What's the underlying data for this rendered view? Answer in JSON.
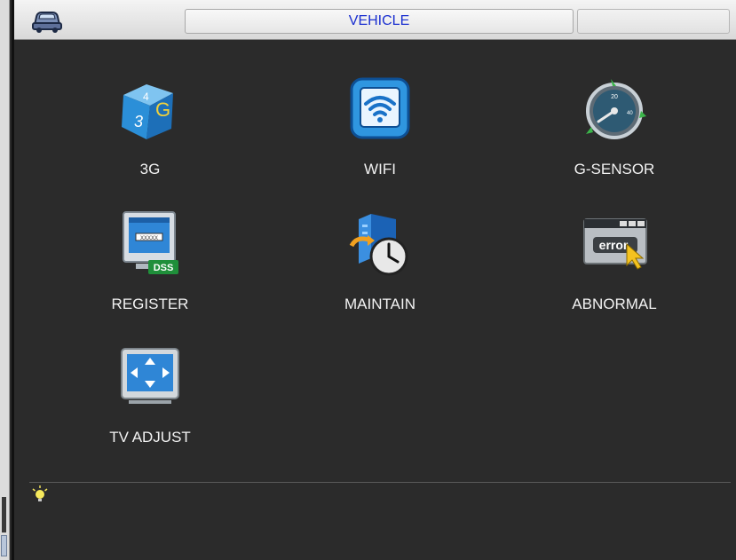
{
  "window": {
    "title": "VEHICLE"
  },
  "items": [
    {
      "label": "3G",
      "icon": "3g-cube-icon"
    },
    {
      "label": "WIFI",
      "icon": "wifi-icon"
    },
    {
      "label": "G-SENSOR",
      "icon": "speedometer-icon"
    },
    {
      "label": "REGISTER",
      "icon": "dss-monitor-icon"
    },
    {
      "label": "MAINTAIN",
      "icon": "server-clock-icon"
    },
    {
      "label": "ABNORMAL",
      "icon": "error-window-icon"
    },
    {
      "label": "TV ADJUST",
      "icon": "tv-adjust-icon"
    }
  ],
  "status": {
    "tip_icon": "lightbulb-icon",
    "tip_text": ""
  },
  "colors": {
    "title_text": "#1a2fd0",
    "background": "#2b2b2b",
    "label": "#f2f2f2"
  }
}
